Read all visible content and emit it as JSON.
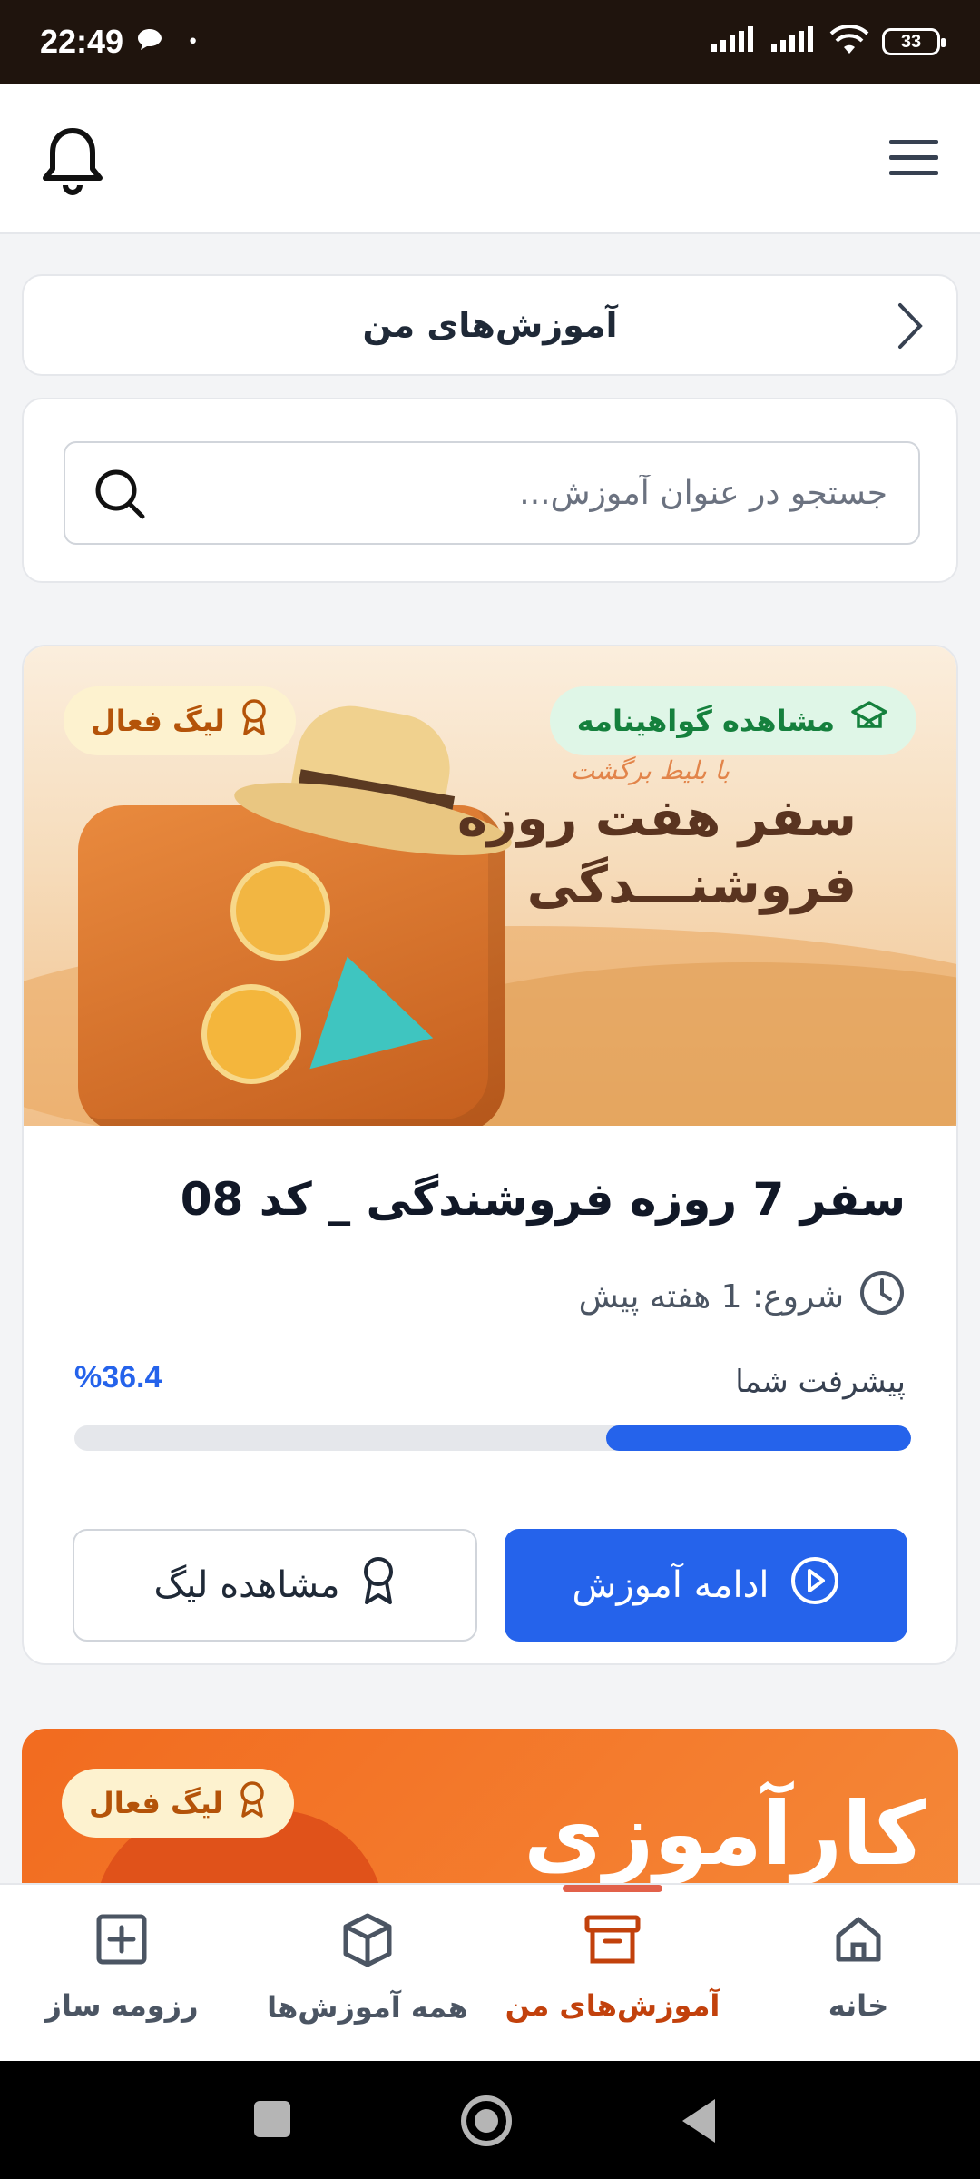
{
  "status_bar": {
    "time": "22:49",
    "dot": "•",
    "battery": "33"
  },
  "header": {
    "title": "آموزش‌های من"
  },
  "search": {
    "placeholder": "جستجو در عنوان آموزش..."
  },
  "course": {
    "banner": {
      "cert_badge": "مشاهده گواهینامه",
      "league_badge": "لیگ فعال",
      "small_text": "با بلیط برگشت",
      "line1": "سفر هفت روزه",
      "line2": "فروشنـــدگی"
    },
    "title": "سفر 7 روزه فروشندگی _ کد 08",
    "start": "شروع: 1 هفته پیش",
    "progress_label": "پیشرفت شما",
    "progress_value": "%36.4",
    "progress_fraction": 0.364,
    "continue_button": "ادامه آموزش",
    "league_button": "مشاهده لیگ"
  },
  "course2": {
    "league_badge": "لیگ فعال",
    "banner_title": "کارآموزی"
  },
  "bottom_nav": {
    "home": "خانه",
    "my_courses": "آموزش‌های من",
    "all_courses": "همه آموزش‌ها",
    "resume": "رزومه ساز"
  },
  "colors": {
    "primary": "#2563eb",
    "active_nav": "#c2410c",
    "cert_green": "#15803d",
    "league_amber": "#b45309"
  }
}
